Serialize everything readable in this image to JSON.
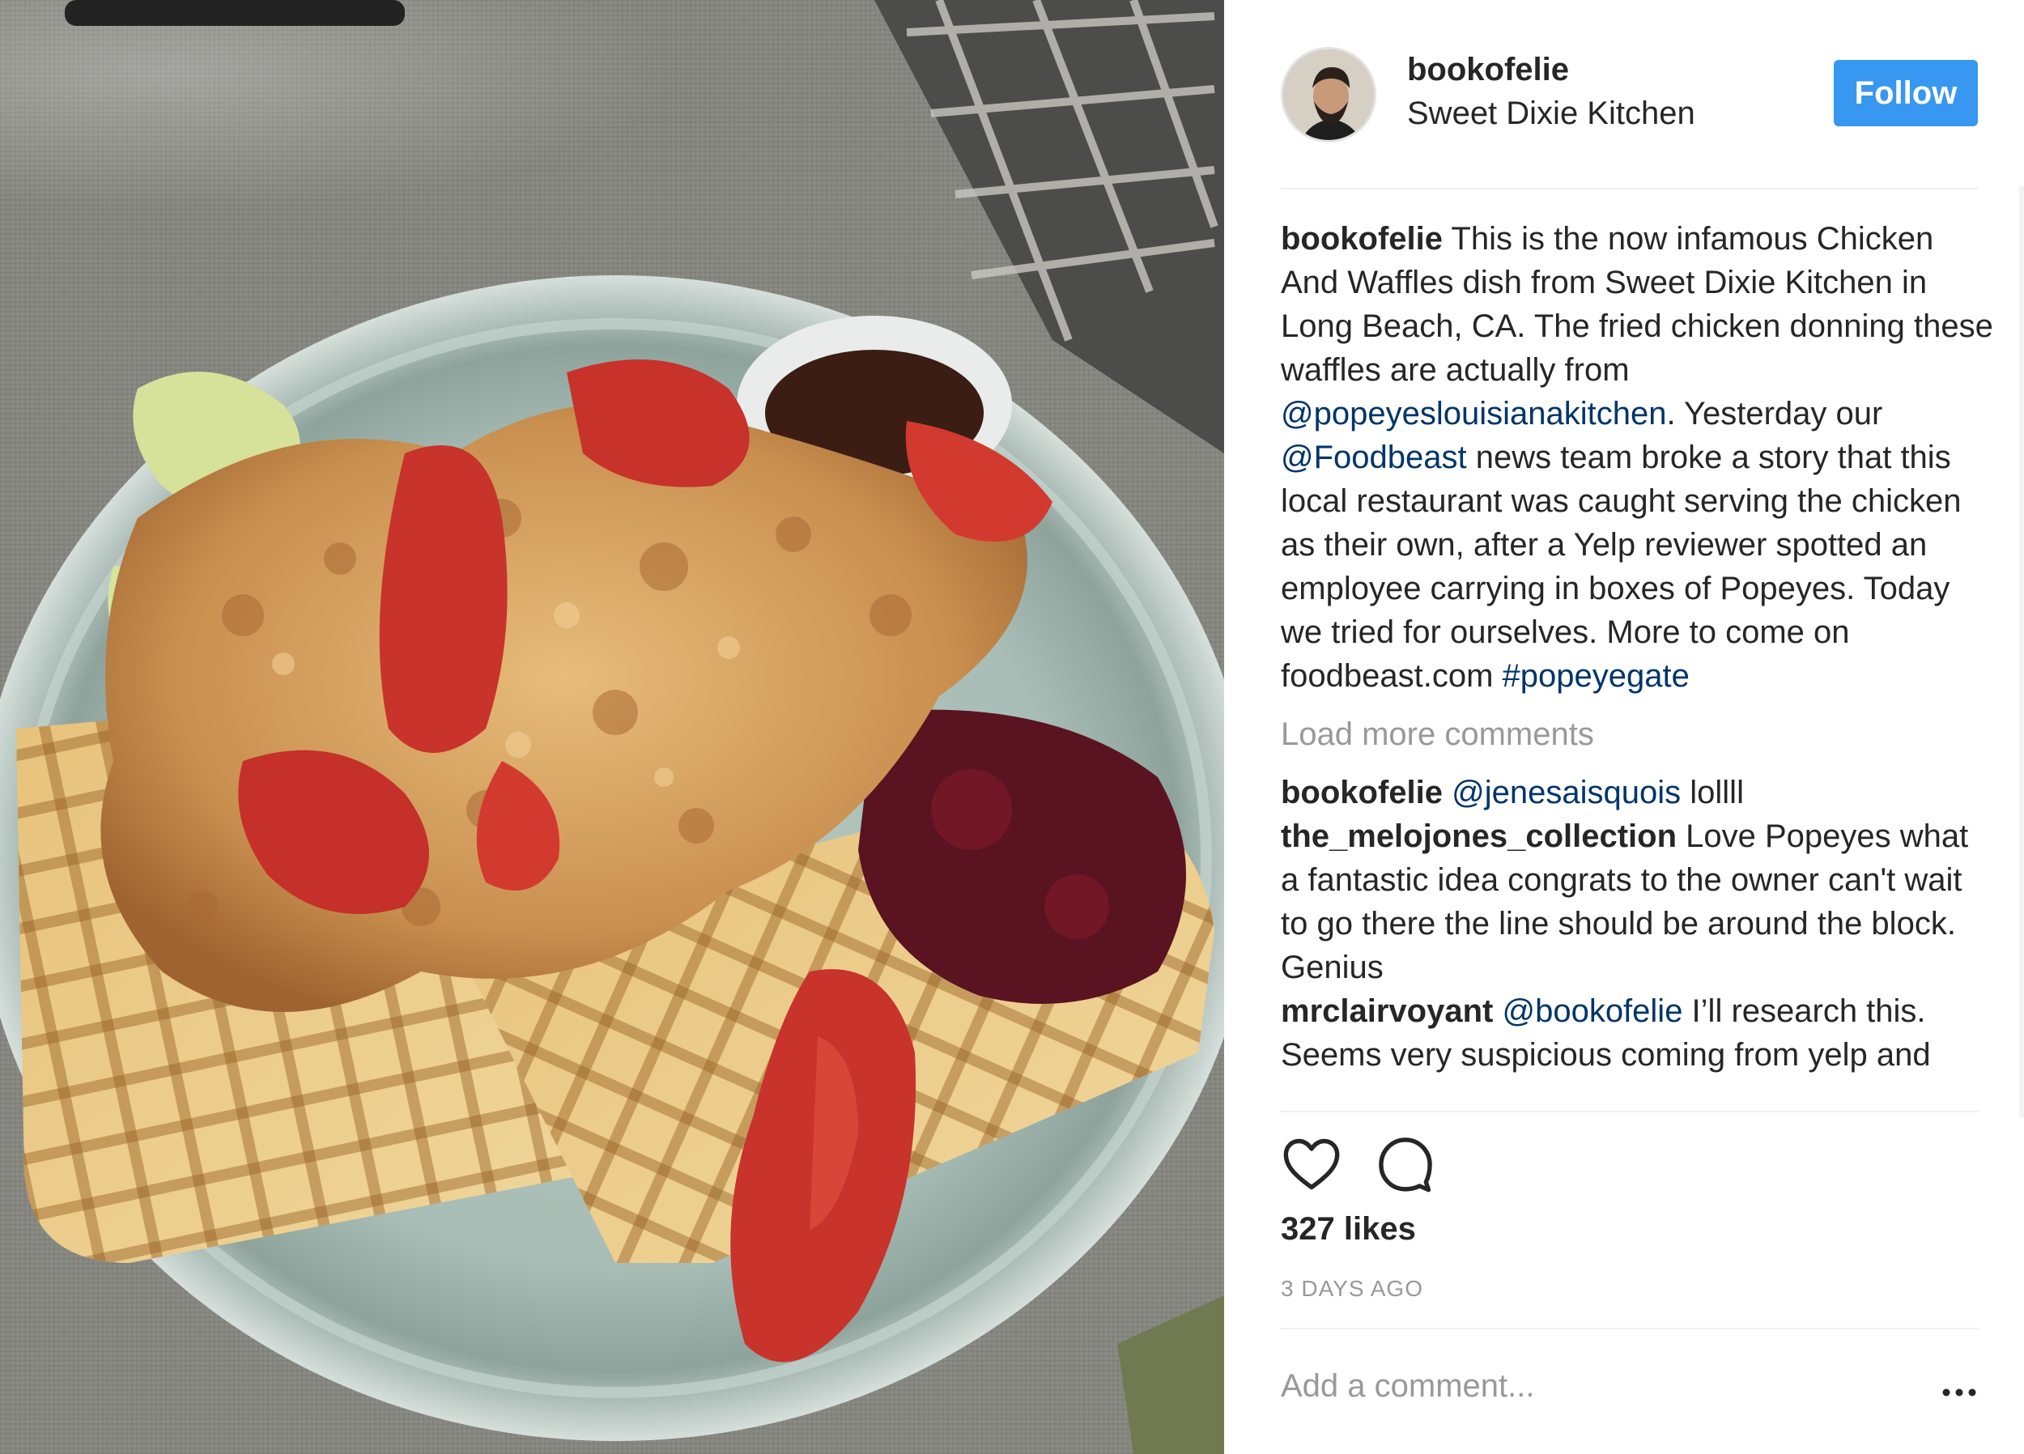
{
  "post": {
    "username": "bookofelie",
    "location": "Sweet Dixie Kitchen",
    "follow_label": "Follow"
  },
  "caption": {
    "username": "bookofelie",
    "text_1": "This is the now infamous Chicken And Waffles dish from Sweet Dixie Kitchen in Long Beach, CA. The fried chicken donning these waffles are actually from ",
    "mention_1": "@popeyeslouisianakitchen",
    "text_2": ". Yesterday our ",
    "mention_2": "@Foodbeast",
    "text_3": " news team broke a story that this local restaurant was caught serving the chicken as their own, after a Yelp reviewer spotted an employee carrying in boxes of Popeyes. Today we tried for ourselves. More to come on foodbeast.com ",
    "hashtag": "#popeyegate"
  },
  "load_more_label": "Load more comments",
  "comments": [
    {
      "username": "bookofelie",
      "mention": "@jenesaisquois",
      "text": " lollll"
    },
    {
      "username": "the_melojones_collection",
      "text": " Love Popeyes what a fantastic idea congrats to the owner can't wait to go there the line should be around the block. Genius"
    },
    {
      "username": "mrclairvoyant",
      "mention": "@bookofelie",
      "text": " I’ll research this. Seems very suspicious coming from yelp and"
    }
  ],
  "likes": "327 likes",
  "timestamp": "3 DAYS AGO",
  "add_comment_placeholder": "Add a comment...",
  "icons": {
    "like": "heart-icon",
    "comment": "comment-bubble-icon",
    "more": "more-options-icon"
  },
  "colors": {
    "follow_button": "#3897f0",
    "link": "#003569",
    "muted": "#999999",
    "text": "#262626"
  }
}
